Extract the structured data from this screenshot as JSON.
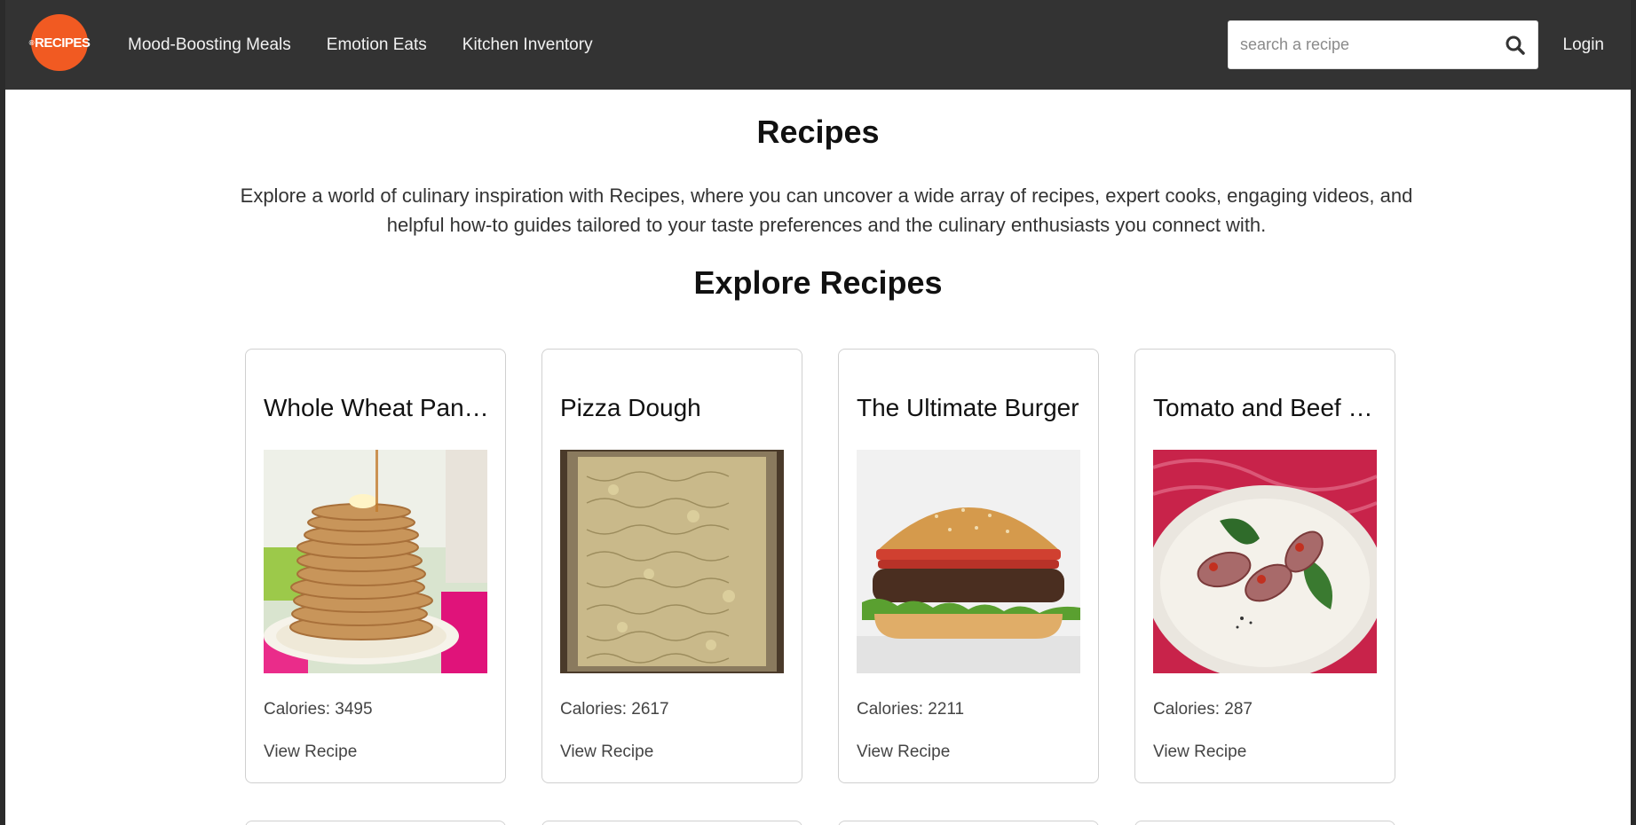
{
  "nav": {
    "logo_text": "RECIPES",
    "logo_mark": "®",
    "links": [
      "Mood-Boosting Meals",
      "Emotion Eats",
      "Kitchen Inventory"
    ],
    "search_placeholder": "search a recipe",
    "search_icon": "search-icon",
    "login": "Login"
  },
  "main": {
    "title": "Recipes",
    "description": "Explore a world of culinary inspiration with Recipes, where you can uncover a wide array of recipes, expert cooks, engaging videos, and helpful how-to guides tailored to your taste preferences and the culinary enthusiasts you connect with.",
    "section_title": "Explore Recipes"
  },
  "cards": [
    {
      "title": "Whole Wheat Pancakes",
      "calories": "Calories: 3495",
      "link": "View Recipe",
      "image": "pancakes-photo"
    },
    {
      "title": "Pizza Dough",
      "calories": "Calories: 2617",
      "link": "View Recipe",
      "image": "pizza-dough-photo"
    },
    {
      "title": "The Ultimate Burger",
      "calories": "Calories: 2211",
      "link": "View Recipe",
      "image": "burger-photo"
    },
    {
      "title": "Tomato and Beef Rolls",
      "calories": "Calories: 287",
      "link": "View Recipe",
      "image": "beef-rolls-photo"
    }
  ],
  "colors": {
    "navbar": "#333333",
    "logo": "#f15a22",
    "text": "#111111"
  }
}
